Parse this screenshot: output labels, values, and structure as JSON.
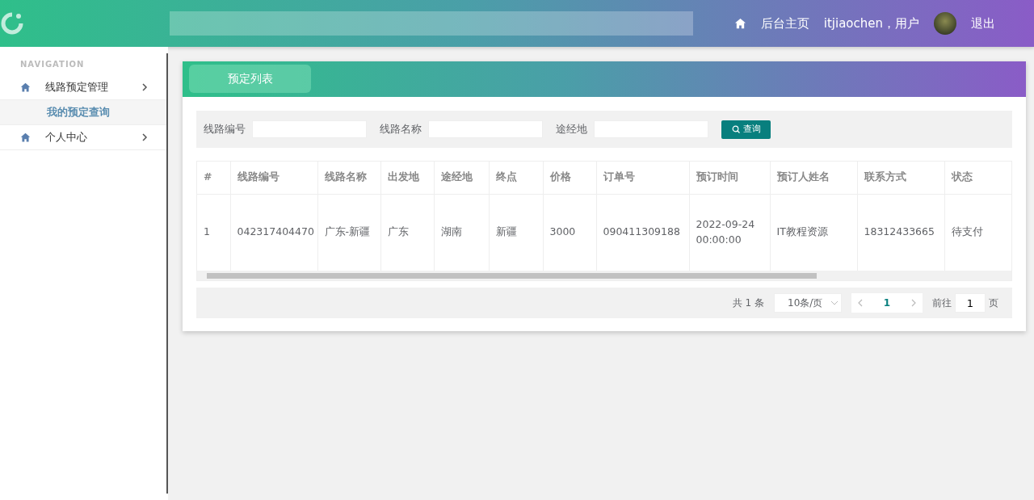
{
  "header": {
    "links": [
      {
        "kind": "home",
        "label": "后台主页"
      },
      {
        "kind": "user",
        "label": "itjiaochen，用户"
      },
      {
        "kind": "logout",
        "label": "退出"
      }
    ]
  },
  "sidebar": {
    "heading": "NAVIGATION",
    "items": [
      {
        "label": "线路预定管理",
        "children": [
          {
            "label": "我的预定查询",
            "selected": true
          }
        ]
      },
      {
        "label": "个人中心"
      }
    ]
  },
  "panel": {
    "tab": "预定列表",
    "filters": [
      {
        "label": "线路编号"
      },
      {
        "label": "线路名称"
      },
      {
        "label": "途经地"
      }
    ],
    "search_button": "查询",
    "table": {
      "columns": [
        "#",
        "线路编号",
        "线路名称",
        "出发地",
        "途经地",
        "终点",
        "价格",
        "订单号",
        "预订时间",
        "预订人姓名",
        "联系方式",
        "状态"
      ],
      "rows": [
        [
          "1",
          "042317404470",
          "广东-新疆",
          "广东",
          "湖南",
          "新疆",
          "3000",
          "090411309188",
          "2022-09-24 00:00:00",
          "IT教程资源",
          "18312433665",
          "待支付"
        ]
      ]
    },
    "pagination": {
      "total": "共 1 条",
      "page_size": "10条/页",
      "pages": [
        {
          "label": "1",
          "selected": true
        }
      ],
      "goto_label": "前往",
      "goto_value": "1",
      "goto_suffix": "页"
    }
  }
}
